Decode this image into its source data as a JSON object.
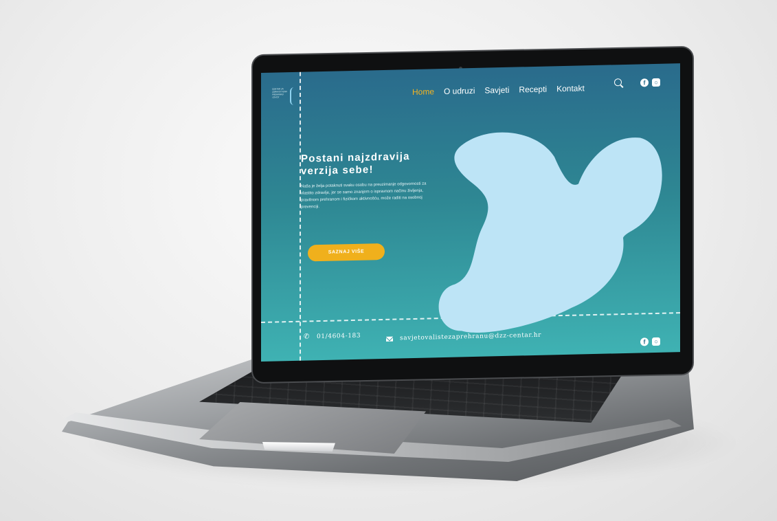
{
  "nav": {
    "items": [
      {
        "label": "Home",
        "active": true
      },
      {
        "label": "O udruzi",
        "active": false
      },
      {
        "label": "Savjeti",
        "active": false
      },
      {
        "label": "Recepti",
        "active": false
      },
      {
        "label": "Kontakt",
        "active": false
      }
    ]
  },
  "logo": {
    "lines": [
      "CENTAR ZA",
      "ZDRAVSTVENU",
      "PREHRANU",
      "I ŽIVOT"
    ]
  },
  "hero": {
    "title_line1": "Postani najzdravija",
    "title_line2": "verzija sebe!",
    "text": "Naša je želja potaknuti svaku osobu na preuzimanje odgovornosti za vlastito zdravlje, jer se samo znanjem o ispravnom načinu življenja, pravilnom prehranom i fizičkom aktivnošću, može raditi na osobnoj prevenciji.",
    "cta_label": "SAZNAJ VIŠE"
  },
  "footer": {
    "phone": "01/4604-183",
    "email": "savjetovalistezaprehranu@dzz-centar.hr"
  },
  "icons": {
    "search": "search-icon",
    "facebook": "facebook-icon",
    "instagram": "instagram-icon",
    "phone": "phone-icon",
    "mail": "mail-icon"
  },
  "colors": {
    "accent": "#f0b01c",
    "active_nav": "#f4b421",
    "blob": "#bde4f6",
    "screen_top": "#2a6b8c",
    "screen_bottom": "#3fb2b3"
  }
}
